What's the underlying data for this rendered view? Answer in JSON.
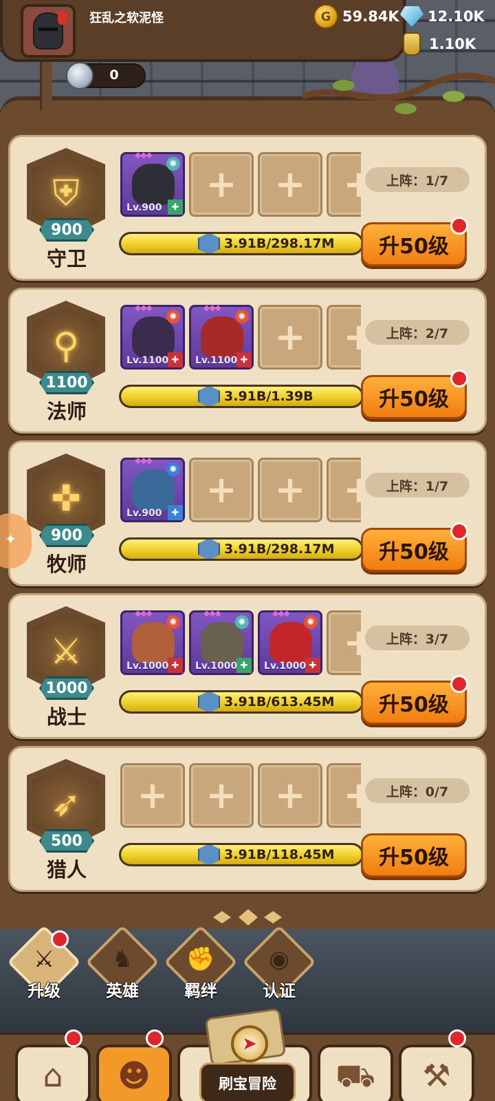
{
  "player": {
    "name": "狂乱之软泥怪"
  },
  "resources": {
    "gold": "59.84K",
    "diamonds": "12.10K",
    "potion": "1.10K",
    "silver": "0"
  },
  "classes": [
    {
      "name": "守卫",
      "level": "900",
      "deploy": "上阵：1/7",
      "progress_text": "3.91B/298.17M",
      "progress": 1.0,
      "button": "升50级",
      "has_dot": true,
      "heroes": [
        {
          "lv": "Lv.900",
          "color": "#2e2f36",
          "elem": "#4fb7b0",
          "role": "#3aa36a"
        }
      ]
    },
    {
      "name": "法师",
      "level": "1100",
      "deploy": "上阵：2/7",
      "progress_text": "3.91B/1.39B",
      "progress": 1.0,
      "button": "升50级",
      "has_dot": true,
      "heroes": [
        {
          "lv": "Lv.1100",
          "color": "#3b2b4e",
          "elem": "#e2563a",
          "role": "#c9323a"
        },
        {
          "lv": "Lv.1100",
          "color": "#a52a28",
          "elem": "#e2563a",
          "role": "#c9323a"
        }
      ]
    },
    {
      "name": "牧师",
      "level": "900",
      "deploy": "上阵：1/7",
      "progress_text": "3.91B/298.17M",
      "progress": 1.0,
      "button": "升50级",
      "has_dot": true,
      "heroes": [
        {
          "lv": "Lv.900",
          "color": "#3b6a9a",
          "elem": "#3b82d6",
          "role": "#3b82d6"
        }
      ]
    },
    {
      "name": "战士",
      "level": "1000",
      "deploy": "上阵：3/7",
      "progress_text": "3.91B/613.45M",
      "progress": 1.0,
      "button": "升50级",
      "has_dot": true,
      "heroes": [
        {
          "lv": "Lv.1000",
          "color": "#b0603a",
          "elem": "#e2563a",
          "role": "#c9323a"
        },
        {
          "lv": "Lv.1000",
          "color": "#6a6050",
          "elem": "#4fb7b0",
          "role": "#3aa36a"
        },
        {
          "lv": "Lv.1000",
          "color": "#c2262a",
          "elem": "#e2563a",
          "role": "#c9323a"
        }
      ]
    },
    {
      "name": "猎人",
      "level": "500",
      "deploy": "上阵：0/7",
      "progress_text": "3.91B/118.45M",
      "progress": 1.0,
      "button": "升50级",
      "has_dot": false,
      "heroes": []
    }
  ],
  "class_icons": [
    "shield-icon",
    "staff-icon",
    "cross-icon",
    "sword-icon",
    "bow-icon"
  ],
  "menu": [
    {
      "label": "升级",
      "icon": "upgrade-icon",
      "active": true,
      "has_dot": true
    },
    {
      "label": "英雄",
      "icon": "hero-icon",
      "active": false,
      "has_dot": false
    },
    {
      "label": "羁绊",
      "icon": "bond-icon",
      "active": false,
      "has_dot": false
    },
    {
      "label": "认证",
      "icon": "certify-icon",
      "active": false,
      "has_dot": false
    }
  ],
  "bottom_nav": {
    "center_label": "刷宝冒险"
  }
}
